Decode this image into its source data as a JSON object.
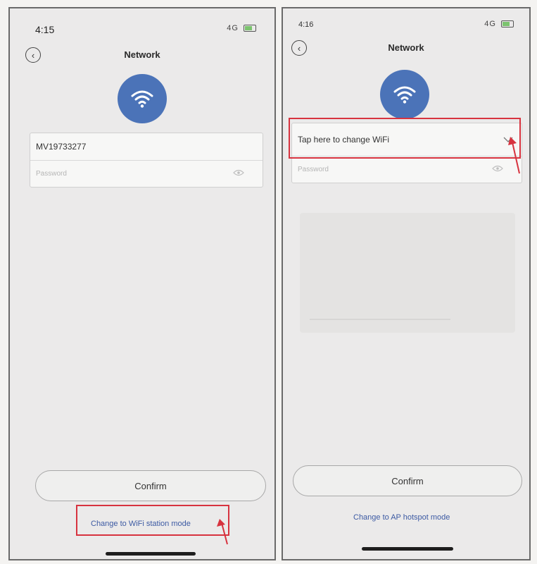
{
  "left_screen": {
    "status_time": "4:15",
    "status_signal": "4G",
    "title": "Network",
    "ssid_value": "MV19733277",
    "password_placeholder": "Password",
    "confirm_label": "Confirm",
    "mode_link": "Change to WiFi station mode"
  },
  "right_screen": {
    "status_time": "4:16",
    "status_signal": "4G",
    "title": "Network",
    "wifi_select_label": "Tap here to change WiFi",
    "password_placeholder": "Password",
    "confirm_label": "Confirm",
    "mode_link": "Change to AP hotspot mode"
  },
  "colors": {
    "accent": "#4b73b8",
    "highlight": "#d7333f",
    "link": "#3c5aa3"
  },
  "icons": [
    "back-icon",
    "wifi-icon",
    "eye-icon",
    "chevron-down-icon",
    "battery-icon"
  ]
}
